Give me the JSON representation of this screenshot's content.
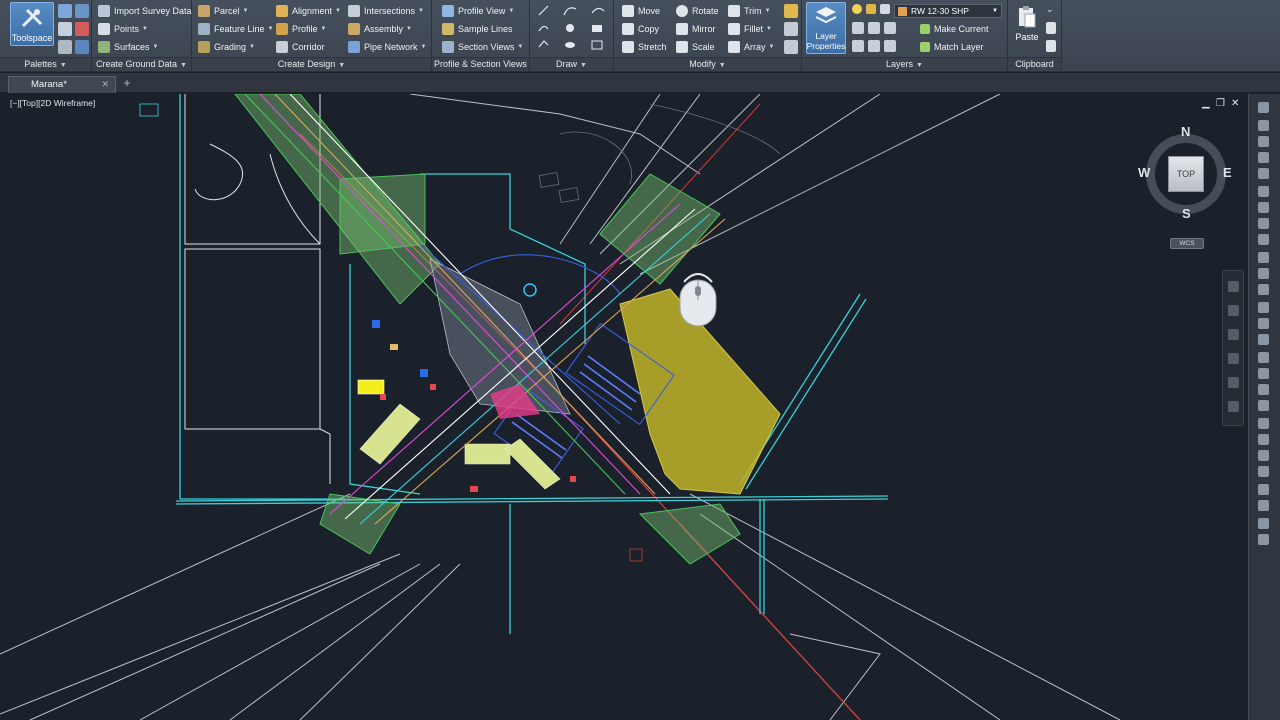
{
  "ribbon": {
    "toolspace": "Toolspace",
    "palettes": {
      "title": "Palettes",
      "small_icons": [
        "toolspace-prospector-icon",
        "survey-icon",
        "properties-icon",
        "layers-icon",
        "grid-icon",
        "screen-icon"
      ]
    },
    "ground_data": {
      "title": "Create Ground Data",
      "items": [
        "Import Survey Data",
        "Points",
        "Surfaces"
      ]
    },
    "design": {
      "title": "Create Design",
      "col1": [
        "Parcel",
        "Feature Line",
        "Grading"
      ],
      "col2": [
        "Alignment",
        "Profile",
        "Corridor"
      ],
      "col3": [
        "Intersections",
        "Assembly",
        "Pipe Network"
      ]
    },
    "profile_views": {
      "title": "Profile & Section Views",
      "items": [
        "Profile View",
        "Sample Lines",
        "Section Views"
      ]
    },
    "draw": {
      "title": "Draw"
    },
    "modify": {
      "title": "Modify",
      "col1": [
        "Move",
        "Copy",
        "Stretch"
      ],
      "col2": [
        "Rotate",
        "Mirror",
        "Scale"
      ],
      "col3": [
        "Trim",
        "Fillet",
        "Array"
      ]
    },
    "layers": {
      "title": "Layers",
      "properties_button": "Layer Properties",
      "current_layer": "RW 12-30 SHP",
      "make_current": "Make Current",
      "match_layer": "Match Layer",
      "current_layer_color": "#e2a14b"
    },
    "clipboard": {
      "title": "Clipboard",
      "paste": "Paste"
    }
  },
  "tabs": {
    "document": "Marana*"
  },
  "viewport": {
    "label": "[−][Top][2D Wireframe]",
    "controls": [
      "minimize-icon",
      "restore-icon",
      "close-icon"
    ]
  },
  "viewcube": {
    "face": "TOP",
    "north": "N",
    "south": "S",
    "east": "E",
    "west": "W",
    "ucs": "WCS"
  },
  "theme": {
    "background": "#1b212b",
    "accent": "#3b6ea6"
  }
}
